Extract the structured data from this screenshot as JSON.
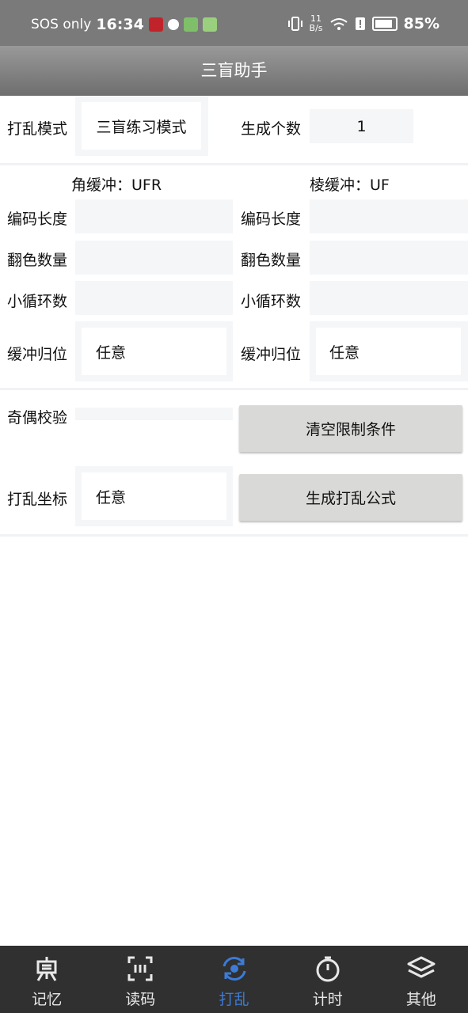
{
  "status_bar": {
    "carrier": "SOS only",
    "time": "16:34",
    "net_speed_value": "11",
    "net_speed_unit": "B/s",
    "battery": "85%"
  },
  "header": {
    "title": "三盲助手"
  },
  "scramble": {
    "mode_label": "打乱模式",
    "mode_value": "三盲练习模式",
    "count_label": "生成个数",
    "count_value": "1"
  },
  "corner": {
    "buffer_label": "角缓冲：UFR",
    "code_length_label": "编码长度",
    "flip_count_label": "翻色数量",
    "cycle_count_label": "小循环数",
    "buffer_home_label": "缓冲归位",
    "buffer_home_value": "任意"
  },
  "edge": {
    "buffer_label": "棱缓冲：UF",
    "code_length_label": "编码长度",
    "flip_count_label": "翻色数量",
    "cycle_count_label": "小循环数",
    "buffer_home_label": "缓冲归位",
    "buffer_home_value": "任意"
  },
  "parity": {
    "label": "奇偶校验"
  },
  "clear_button": "清空限制条件",
  "coord": {
    "label": "打乱坐标",
    "value": "任意"
  },
  "generate_button": "生成打乱公式",
  "bottom_nav": {
    "items": [
      {
        "label": "记忆",
        "icon": "memory-icon"
      },
      {
        "label": "读码",
        "icon": "scan-code-icon"
      },
      {
        "label": "打乱",
        "icon": "scramble-icon"
      },
      {
        "label": "计时",
        "icon": "timer-icon"
      },
      {
        "label": "其他",
        "icon": "layers-icon"
      }
    ],
    "active_index": 2
  },
  "colors": {
    "accent": "#3d7bd6",
    "nav_bg": "#303030",
    "button_bg": "#d9dad8"
  }
}
